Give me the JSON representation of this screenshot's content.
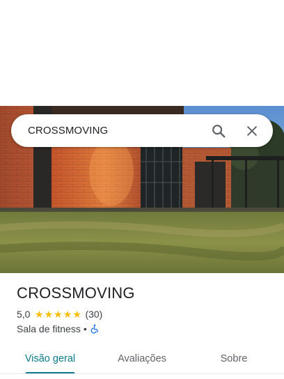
{
  "search": {
    "query": "CROSSMOVING"
  },
  "place": {
    "title": "CROSSMOVING",
    "rating": "5,0",
    "review_count": "(30)",
    "category": "Sala de fitness",
    "separator": "•",
    "stars": [
      "★",
      "★",
      "★",
      "★",
      "★"
    ]
  },
  "tabs": [
    {
      "label": "Visão geral",
      "selected": true
    },
    {
      "label": "Avaliações",
      "selected": false
    },
    {
      "label": "Sobre",
      "selected": false
    }
  ],
  "colors": {
    "accent": "#0b7a8a",
    "star": "#fbbc04",
    "accessibility": "#1a73e8"
  },
  "icons": {
    "search": "search-icon",
    "close": "close-icon",
    "accessibility": "wheelchair-accessible-icon"
  }
}
